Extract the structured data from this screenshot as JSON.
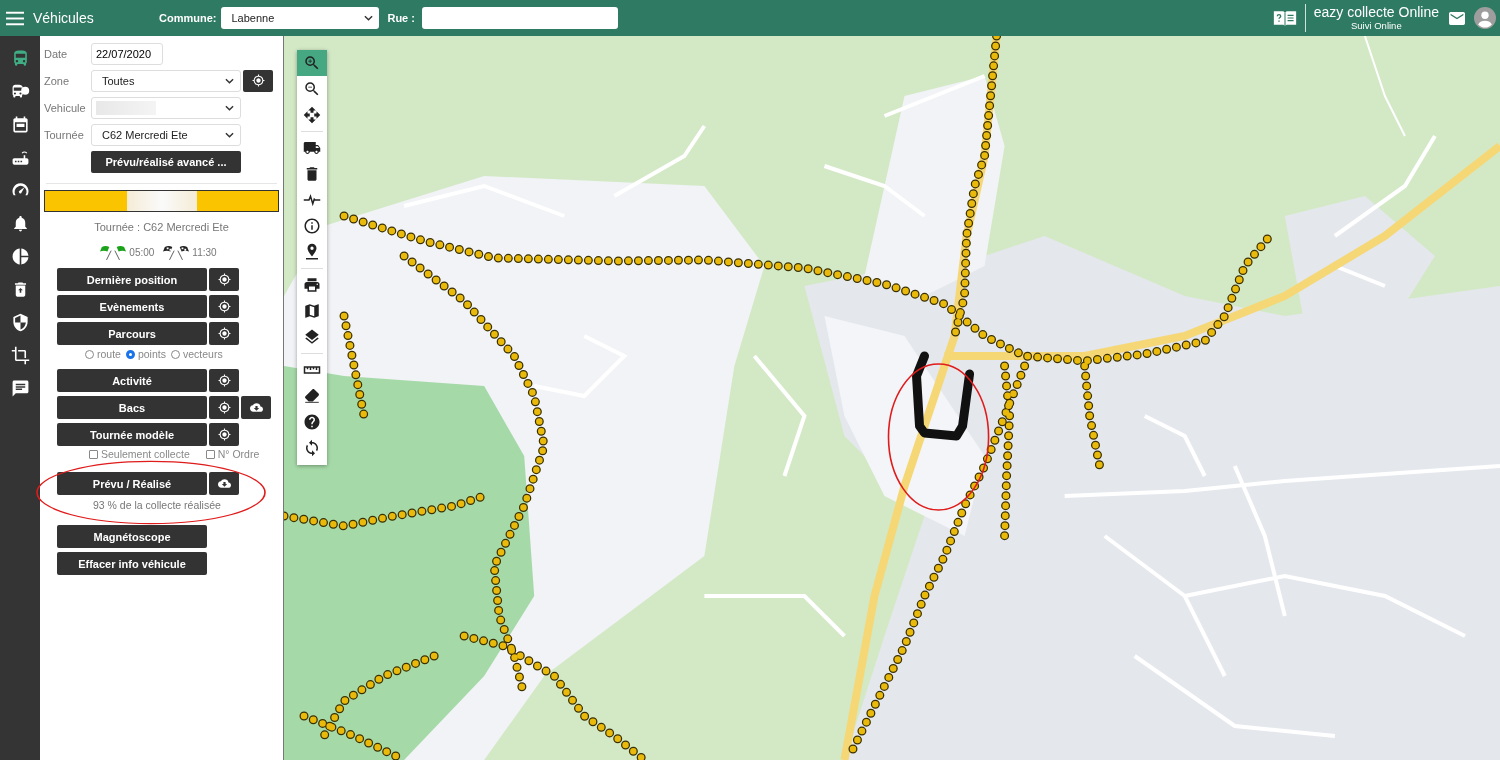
{
  "header": {
    "title": "Véhicules",
    "commune_label": "Commune:",
    "commune_value": "Labenne",
    "rue_label": "Rue :",
    "app_title": "eazy collecte Online",
    "app_subtitle": "Suivi Online"
  },
  "nav": [
    {
      "kind": "bus",
      "selected": true
    },
    {
      "kind": "bus-clock",
      "selected": false
    },
    {
      "kind": "calendar",
      "selected": false
    },
    {
      "kind": "router",
      "selected": false
    },
    {
      "kind": "gauge",
      "selected": false
    },
    {
      "kind": "bell",
      "selected": false
    },
    {
      "kind": "pie",
      "selected": false
    },
    {
      "kind": "bin",
      "selected": false
    },
    {
      "kind": "shield",
      "selected": false
    },
    {
      "kind": "crop",
      "selected": false
    },
    {
      "kind": "chat",
      "selected": false
    }
  ],
  "form": {
    "fields": [
      {
        "label": "Date",
        "value": "22/07/2020",
        "kind": "input",
        "locate": false
      },
      {
        "label": "Zone",
        "value": "Toutes",
        "kind": "select",
        "locate": true
      },
      {
        "label": "Vehicule",
        "kind": "select",
        "locate": false
      },
      {
        "label": "Tournée",
        "value": "C62 Mercredi Ete",
        "kind": "select",
        "locate": false
      }
    ],
    "advanced_button": "Prévu/réalisé avancé ..."
  },
  "route": {
    "title": "Tournée : C62 Mercredi Ete",
    "start": "05:00",
    "end": "11:30"
  },
  "actions": [
    {
      "label": "Dernière position",
      "locate": true,
      "download": false
    },
    {
      "label": "Evènements",
      "locate": true,
      "download": false
    },
    {
      "label": "Parcours",
      "locate": true,
      "download": false,
      "radios": [
        {
          "label": "route",
          "selected": false
        },
        {
          "label": "points",
          "selected": true
        },
        {
          "label": "vecteurs",
          "selected": false
        }
      ]
    },
    {
      "label": "Activité",
      "locate": true,
      "download": false
    },
    {
      "label": "Bacs",
      "locate": true,
      "download": true
    },
    {
      "label": "Tournée modèle",
      "locate": true,
      "download": false,
      "checkboxes": [
        {
          "label": "Seulement collecte",
          "checked": false
        },
        {
          "label": "N° Ordre",
          "checked": false
        }
      ]
    },
    {
      "label": "Prévu / Réalisé",
      "locate": false,
      "download": true,
      "note": "93 % de la collecte réalisée",
      "circled": true
    },
    {
      "label": "Magnétoscope",
      "locate": false,
      "download": false
    },
    {
      "label": "Effacer info véhicule",
      "locate": false,
      "download": false
    }
  ],
  "toolbar": [
    [
      {
        "kind": "zoom-in",
        "selected": true
      },
      {
        "kind": "zoom-out",
        "selected": false
      },
      {
        "kind": "move",
        "selected": false
      }
    ],
    [
      {
        "kind": "truck",
        "selected": false
      },
      {
        "kind": "trash",
        "selected": false
      },
      {
        "kind": "pulse",
        "selected": false
      },
      {
        "kind": "info",
        "selected": false
      },
      {
        "kind": "pin",
        "selected": false
      }
    ],
    [
      {
        "kind": "print",
        "selected": false
      },
      {
        "kind": "map",
        "selected": false
      },
      {
        "kind": "layers",
        "selected": false
      }
    ],
    [
      {
        "kind": "ruler",
        "selected": false
      },
      {
        "kind": "eraser",
        "selected": false
      },
      {
        "kind": "help",
        "selected": false
      },
      {
        "kind": "sync",
        "selected": false
      }
    ]
  ]
}
